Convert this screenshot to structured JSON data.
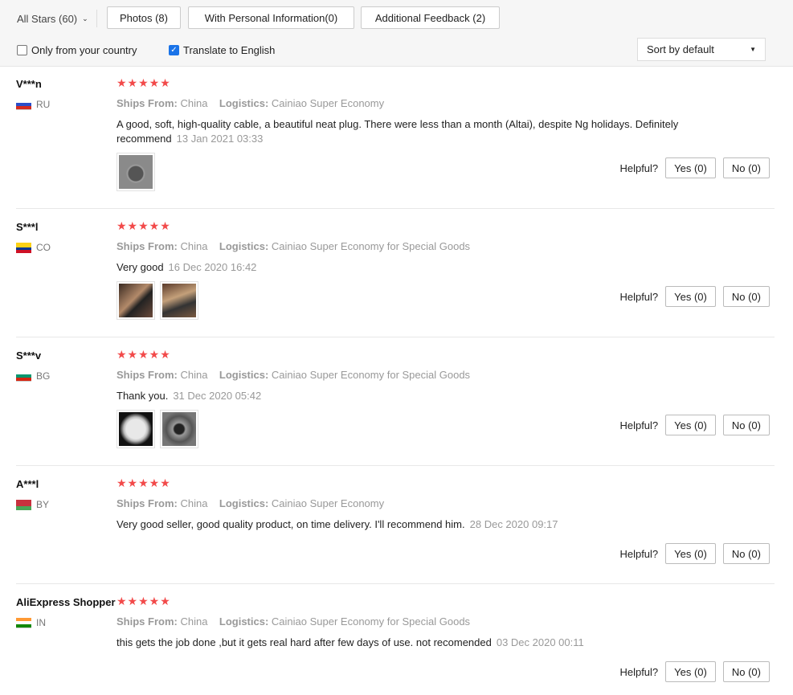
{
  "filters": {
    "stars_select": "All Stars (60)",
    "photos": "Photos (8)",
    "personal": "With Personal Information(0)",
    "additional": "Additional Feedback (2)",
    "only_country": "Only from your country",
    "only_country_checked": false,
    "translate": "Translate to English",
    "translate_checked": true,
    "sort": "Sort by default"
  },
  "labels": {
    "ships_from": "Ships From:",
    "logistics": "Logistics:",
    "helpful": "Helpful?"
  },
  "colors": {
    "star": "#f24a4a",
    "checkbox_on": "#1a73e8"
  },
  "reviews": [
    {
      "user": "V***n",
      "country": "RU",
      "stars": "★★★★★",
      "ships": "China",
      "logistics": "Cainiao Super Economy",
      "text": "A good, soft, high-quality cable, a beautiful neat plug. There were less than a month (Altai), despite Ng holidays. Definitely recommend",
      "date": "13 Jan 2021 03:33",
      "yes": "Yes (0)",
      "no": "No (0)"
    },
    {
      "user": "S***l",
      "country": "CO",
      "stars": "★★★★★",
      "ships": "China",
      "logistics": "Cainiao Super Economy for Special Goods",
      "text": "Very good",
      "date": "16 Dec 2020 16:42",
      "yes": "Yes (0)",
      "no": "No (0)"
    },
    {
      "user": "S***v",
      "country": "BG",
      "stars": "★★★★★",
      "ships": "China",
      "logistics": "Cainiao Super Economy for Special Goods",
      "text": "Thank you.",
      "date": "31 Dec 2020 05:42",
      "yes": "Yes (0)",
      "no": "No (0)"
    },
    {
      "user": "A***l",
      "country": "BY",
      "stars": "★★★★★",
      "ships": "China",
      "logistics": "Cainiao Super Economy",
      "text": "Very good seller, good quality product, on time delivery. I'll recommend him.",
      "date": "28 Dec 2020 09:17",
      "yes": "Yes (0)",
      "no": "No (0)"
    },
    {
      "user": "AliExpress Shopper",
      "country": "IN",
      "stars": "★★★★★",
      "ships": "China",
      "logistics": "Cainiao Super Economy for Special Goods",
      "text": "this gets the job done ,but it gets real hard after few days of use. not recomended",
      "date": "03 Dec 2020 00:11",
      "yes": "Yes (0)",
      "no": "No (0)"
    }
  ]
}
